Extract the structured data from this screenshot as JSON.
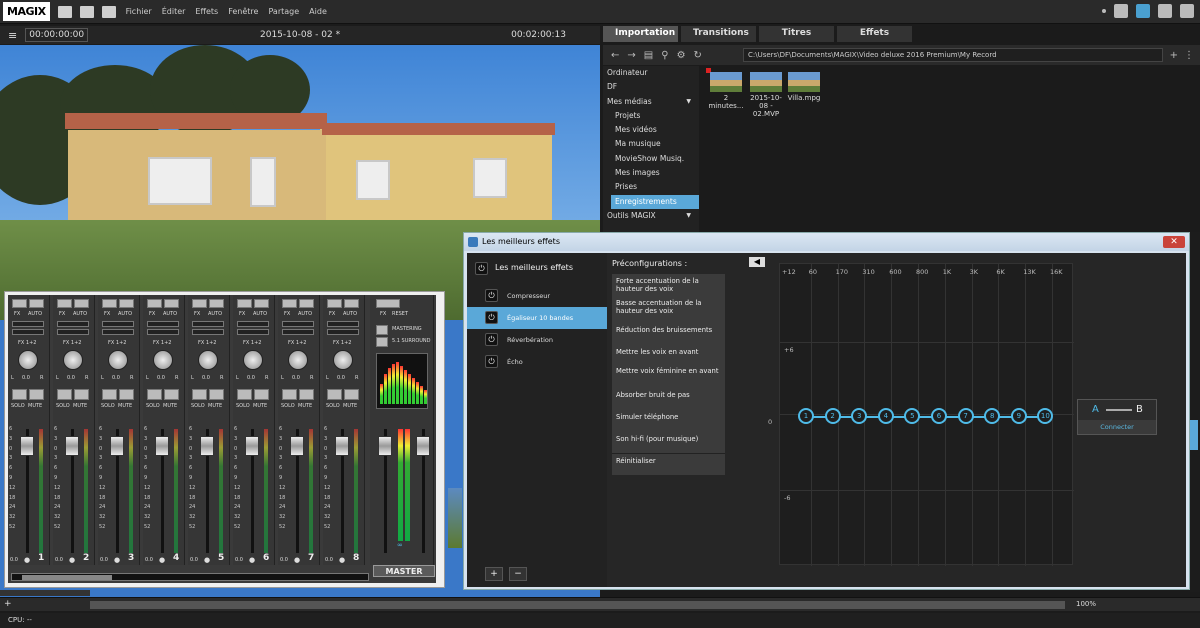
{
  "app": {
    "logo": "MAGIX",
    "menu": [
      "Fichier",
      "Éditer",
      "Effets",
      "Fenêtre",
      "Partage",
      "Aide"
    ]
  },
  "video_header": {
    "timecode_in": "00:00:00:00",
    "title": "2015-10-08 - 02 *",
    "timecode_duration": "00:02:00:13"
  },
  "browser": {
    "tabs": [
      "Importation",
      "Transitions",
      "Titres",
      "Effets"
    ],
    "path": "C:\\Users\\DF\\Documents\\MAGIX\\Video deluxe 2016 Premium\\My Record",
    "tree": [
      {
        "label": "Ordinateur"
      },
      {
        "label": "DF"
      },
      {
        "label": "Mes médias"
      },
      {
        "label": "Projets"
      },
      {
        "label": "Mes vidéos"
      },
      {
        "label": "Ma musique"
      },
      {
        "label": "MovieShow Musiq."
      },
      {
        "label": "Mes images"
      },
      {
        "label": "Prises"
      },
      {
        "label": "Enregistrements"
      },
      {
        "label": "Outils MAGIX"
      }
    ],
    "files": [
      "2 minutes...",
      "2015-10-08 - 02.MVP",
      "Villa.mpg"
    ]
  },
  "mixer": {
    "fx": "FX",
    "auto": "AUTO",
    "fx12": "FX 1+2",
    "solo": "SOLO",
    "mute": "MUTE",
    "l": "L",
    "r": "R",
    "val": "0.0",
    "reset": "RESET",
    "mastering": "MASTERING",
    "surround": "5.1 SURROUND",
    "master": "MASTER",
    "channels": [
      "1",
      "2",
      "3",
      "4",
      "5",
      "6",
      "7",
      "8"
    ],
    "scale": [
      "6",
      "3",
      "0",
      "3",
      "6",
      "9",
      "12",
      "18",
      "24",
      "32",
      "52"
    ],
    "close": "×"
  },
  "eq": {
    "window_title": "Les meilleurs effets",
    "left_header": "Les meilleurs effets",
    "effects": [
      "Compresseur",
      "Égaliseur 10 bandes",
      "Réverbération",
      "Écho"
    ],
    "presets_header": "Préconfigurations :",
    "presets": [
      "Forte accentuation de la hauteur des voix",
      "Basse accentuation de la hauteur des voix",
      "Réduction des bruissements",
      "Mettre les voix en avant",
      "Mettre voix féminine en avant",
      "Absorber bruit de pas",
      "Simuler téléphone",
      "Son hi-fi (pour musique)",
      "Réinitialiser"
    ],
    "freq_labels": [
      "+12",
      "60",
      "170",
      "310",
      "600",
      "800",
      "1K",
      "3K",
      "6K",
      "13K",
      "16K"
    ],
    "db_labels": [
      "+6",
      "0",
      "-6"
    ],
    "bands": [
      "1",
      "2",
      "3",
      "4",
      "5",
      "6",
      "7",
      "8",
      "9",
      "10"
    ],
    "ab": {
      "a": "A",
      "b": "B",
      "connect": "Connecter"
    },
    "plus": "+",
    "minus": "−"
  },
  "bottom": {
    "zoom": "100%",
    "cpu": "CPU: --"
  }
}
